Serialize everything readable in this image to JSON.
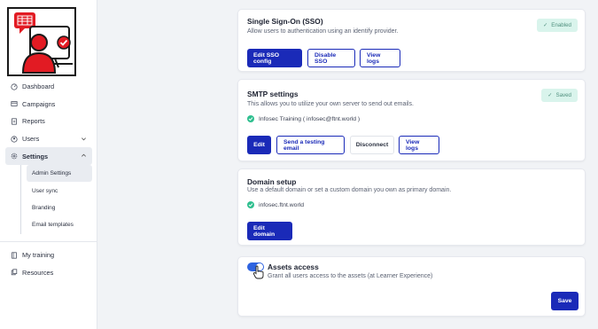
{
  "sidebar": {
    "nav": [
      {
        "label": "Dashboard",
        "icon": "dashboard-icon"
      },
      {
        "label": "Campaigns",
        "icon": "campaigns-icon"
      },
      {
        "label": "Reports",
        "icon": "reports-icon"
      },
      {
        "label": "Users",
        "icon": "users-icon"
      },
      {
        "label": "Settings",
        "icon": "settings-icon"
      }
    ],
    "settings_sub": [
      "Admin Settings",
      "User sync",
      "Branding",
      "Email templates"
    ],
    "bottom": [
      {
        "label": "My training",
        "icon": "training-icon"
      },
      {
        "label": "Resources",
        "icon": "resources-icon"
      }
    ]
  },
  "sso": {
    "title": "Single Sign-On (SSO)",
    "desc": "Allow users to authentication using an identify provider.",
    "badge": "Enabled",
    "buttons": [
      "Edit SSO config",
      "Disable SSO",
      "View logs"
    ]
  },
  "smtp": {
    "title": "SMTP settings",
    "desc": "This allows you to utilize your own server to send out emails.",
    "badge": "Saved",
    "account": "Infosec Training ( infosec@ftnt.world )",
    "buttons": [
      "Edit",
      "Send a testing email",
      "Disconnect",
      "View logs"
    ]
  },
  "domain": {
    "title": "Domain setup",
    "desc": "Use a default domain or set a custom domain you own as primary domain.",
    "value": "infosec.ftnt.world",
    "button": "Edit domain"
  },
  "assets": {
    "title": "Assets access",
    "desc": "Grant all users access to the assets (at Learner Experience)",
    "toggle_on": true,
    "save": "Save"
  },
  "colors": {
    "accent": "#1a2ab8",
    "success": "#2fbf8f",
    "badge_bg": "#d9f4ec",
    "logo_red": "#e21b23"
  }
}
